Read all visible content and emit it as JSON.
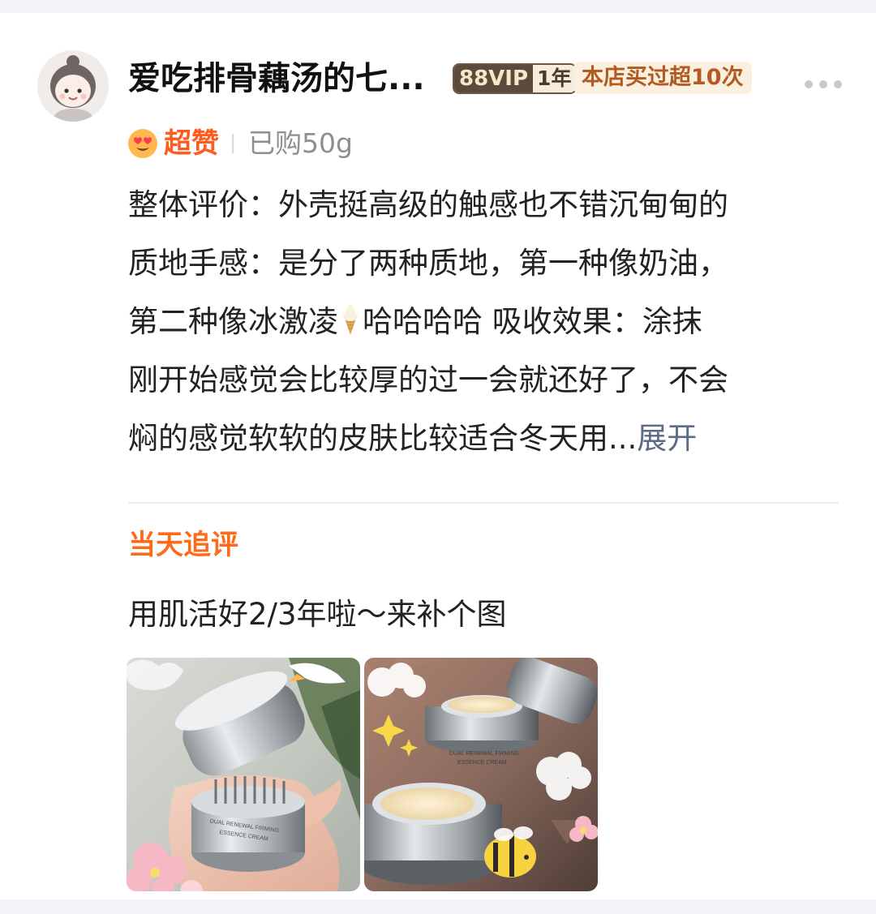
{
  "review": {
    "user": {
      "name": "爱吃排骨藕汤的七...",
      "vip_label": "88VIP",
      "vip_years": "1年",
      "shop_badge": "本店买过超10次"
    },
    "rating": {
      "label": "超赞",
      "icon": "heart-eyes-icon"
    },
    "purchase_spec": "已购50g",
    "body_lines": [
      "整体评价：外壳挺高级的触感也不错沉甸甸的",
      "质地手感：是分了两种质地，第一种像奶油，",
      "第二种像冰激凌",
      "哈哈哈哈  吸收效果：涂抹",
      "刚开始感觉会比较厚的过一会就还好了，不会",
      "焖的感觉软软的皮肤比较适合冬天用..."
    ],
    "expand_label": "展开",
    "followup": {
      "title": "当天追评",
      "text": "用肌活好2/3年啦～来补个图"
    },
    "photos": [
      {
        "name": "product-photo-hand",
        "product_print": [
          "DUAL RENEWAL FIRMING",
          "ESSENCE CREAM"
        ]
      },
      {
        "name": "product-photo-open-jars",
        "product_print": [
          "DUAL RENEWAL FIRMING",
          "ESSENCE CREAM"
        ]
      }
    ]
  },
  "colors": {
    "rating_accent": "#ff5a1f",
    "followup_accent": "#ff6a1a",
    "expand_link": "#5b6b85",
    "vip_dark": "#5c4a3c",
    "shop_badge_bg": "#fbefe0",
    "shop_badge_text": "#b15a22"
  }
}
